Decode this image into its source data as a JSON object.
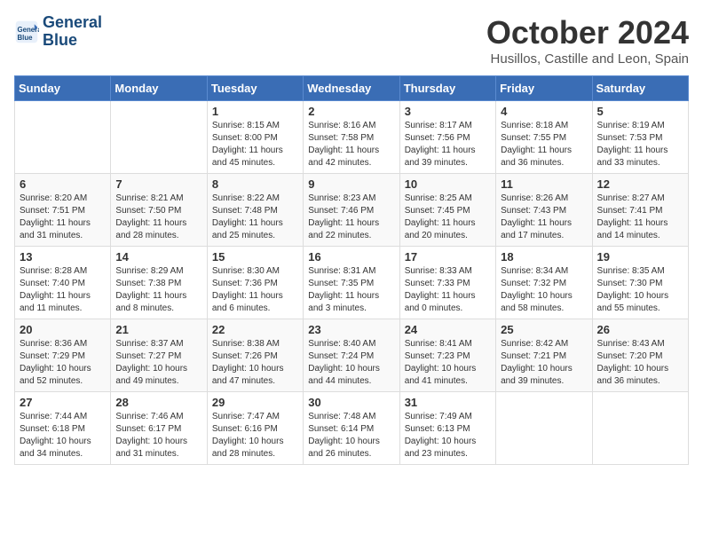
{
  "logo": {
    "line1": "General",
    "line2": "Blue"
  },
  "title": "October 2024",
  "location": "Husillos, Castille and Leon, Spain",
  "weekdays": [
    "Sunday",
    "Monday",
    "Tuesday",
    "Wednesday",
    "Thursday",
    "Friday",
    "Saturday"
  ],
  "weeks": [
    [
      {
        "day": "",
        "info": ""
      },
      {
        "day": "",
        "info": ""
      },
      {
        "day": "1",
        "info": "Sunrise: 8:15 AM\nSunset: 8:00 PM\nDaylight: 11 hours and 45 minutes."
      },
      {
        "day": "2",
        "info": "Sunrise: 8:16 AM\nSunset: 7:58 PM\nDaylight: 11 hours and 42 minutes."
      },
      {
        "day": "3",
        "info": "Sunrise: 8:17 AM\nSunset: 7:56 PM\nDaylight: 11 hours and 39 minutes."
      },
      {
        "day": "4",
        "info": "Sunrise: 8:18 AM\nSunset: 7:55 PM\nDaylight: 11 hours and 36 minutes."
      },
      {
        "day": "5",
        "info": "Sunrise: 8:19 AM\nSunset: 7:53 PM\nDaylight: 11 hours and 33 minutes."
      }
    ],
    [
      {
        "day": "6",
        "info": "Sunrise: 8:20 AM\nSunset: 7:51 PM\nDaylight: 11 hours and 31 minutes."
      },
      {
        "day": "7",
        "info": "Sunrise: 8:21 AM\nSunset: 7:50 PM\nDaylight: 11 hours and 28 minutes."
      },
      {
        "day": "8",
        "info": "Sunrise: 8:22 AM\nSunset: 7:48 PM\nDaylight: 11 hours and 25 minutes."
      },
      {
        "day": "9",
        "info": "Sunrise: 8:23 AM\nSunset: 7:46 PM\nDaylight: 11 hours and 22 minutes."
      },
      {
        "day": "10",
        "info": "Sunrise: 8:25 AM\nSunset: 7:45 PM\nDaylight: 11 hours and 20 minutes."
      },
      {
        "day": "11",
        "info": "Sunrise: 8:26 AM\nSunset: 7:43 PM\nDaylight: 11 hours and 17 minutes."
      },
      {
        "day": "12",
        "info": "Sunrise: 8:27 AM\nSunset: 7:41 PM\nDaylight: 11 hours and 14 minutes."
      }
    ],
    [
      {
        "day": "13",
        "info": "Sunrise: 8:28 AM\nSunset: 7:40 PM\nDaylight: 11 hours and 11 minutes."
      },
      {
        "day": "14",
        "info": "Sunrise: 8:29 AM\nSunset: 7:38 PM\nDaylight: 11 hours and 8 minutes."
      },
      {
        "day": "15",
        "info": "Sunrise: 8:30 AM\nSunset: 7:36 PM\nDaylight: 11 hours and 6 minutes."
      },
      {
        "day": "16",
        "info": "Sunrise: 8:31 AM\nSunset: 7:35 PM\nDaylight: 11 hours and 3 minutes."
      },
      {
        "day": "17",
        "info": "Sunrise: 8:33 AM\nSunset: 7:33 PM\nDaylight: 11 hours and 0 minutes."
      },
      {
        "day": "18",
        "info": "Sunrise: 8:34 AM\nSunset: 7:32 PM\nDaylight: 10 hours and 58 minutes."
      },
      {
        "day": "19",
        "info": "Sunrise: 8:35 AM\nSunset: 7:30 PM\nDaylight: 10 hours and 55 minutes."
      }
    ],
    [
      {
        "day": "20",
        "info": "Sunrise: 8:36 AM\nSunset: 7:29 PM\nDaylight: 10 hours and 52 minutes."
      },
      {
        "day": "21",
        "info": "Sunrise: 8:37 AM\nSunset: 7:27 PM\nDaylight: 10 hours and 49 minutes."
      },
      {
        "day": "22",
        "info": "Sunrise: 8:38 AM\nSunset: 7:26 PM\nDaylight: 10 hours and 47 minutes."
      },
      {
        "day": "23",
        "info": "Sunrise: 8:40 AM\nSunset: 7:24 PM\nDaylight: 10 hours and 44 minutes."
      },
      {
        "day": "24",
        "info": "Sunrise: 8:41 AM\nSunset: 7:23 PM\nDaylight: 10 hours and 41 minutes."
      },
      {
        "day": "25",
        "info": "Sunrise: 8:42 AM\nSunset: 7:21 PM\nDaylight: 10 hours and 39 minutes."
      },
      {
        "day": "26",
        "info": "Sunrise: 8:43 AM\nSunset: 7:20 PM\nDaylight: 10 hours and 36 minutes."
      }
    ],
    [
      {
        "day": "27",
        "info": "Sunrise: 7:44 AM\nSunset: 6:18 PM\nDaylight: 10 hours and 34 minutes."
      },
      {
        "day": "28",
        "info": "Sunrise: 7:46 AM\nSunset: 6:17 PM\nDaylight: 10 hours and 31 minutes."
      },
      {
        "day": "29",
        "info": "Sunrise: 7:47 AM\nSunset: 6:16 PM\nDaylight: 10 hours and 28 minutes."
      },
      {
        "day": "30",
        "info": "Sunrise: 7:48 AM\nSunset: 6:14 PM\nDaylight: 10 hours and 26 minutes."
      },
      {
        "day": "31",
        "info": "Sunrise: 7:49 AM\nSunset: 6:13 PM\nDaylight: 10 hours and 23 minutes."
      },
      {
        "day": "",
        "info": ""
      },
      {
        "day": "",
        "info": ""
      }
    ]
  ]
}
